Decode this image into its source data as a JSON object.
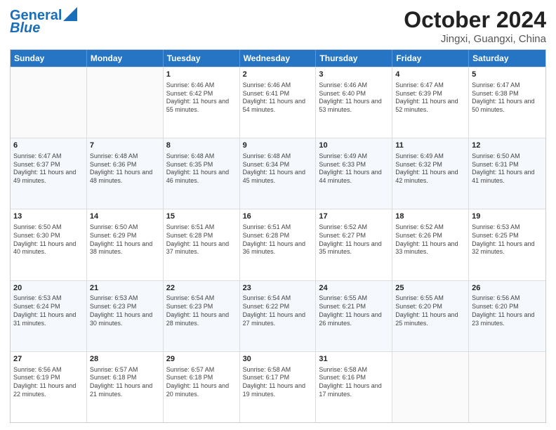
{
  "logo": {
    "line1": "General",
    "line2": "Blue"
  },
  "title": "October 2024",
  "subtitle": "Jingxi, Guangxi, China",
  "weekdays": [
    "Sunday",
    "Monday",
    "Tuesday",
    "Wednesday",
    "Thursday",
    "Friday",
    "Saturday"
  ],
  "weeks": [
    [
      {
        "day": "",
        "sunrise": "",
        "sunset": "",
        "daylight": ""
      },
      {
        "day": "",
        "sunrise": "",
        "sunset": "",
        "daylight": ""
      },
      {
        "day": "1",
        "sunrise": "Sunrise: 6:46 AM",
        "sunset": "Sunset: 6:42 PM",
        "daylight": "Daylight: 11 hours and 55 minutes."
      },
      {
        "day": "2",
        "sunrise": "Sunrise: 6:46 AM",
        "sunset": "Sunset: 6:41 PM",
        "daylight": "Daylight: 11 hours and 54 minutes."
      },
      {
        "day": "3",
        "sunrise": "Sunrise: 6:46 AM",
        "sunset": "Sunset: 6:40 PM",
        "daylight": "Daylight: 11 hours and 53 minutes."
      },
      {
        "day": "4",
        "sunrise": "Sunrise: 6:47 AM",
        "sunset": "Sunset: 6:39 PM",
        "daylight": "Daylight: 11 hours and 52 minutes."
      },
      {
        "day": "5",
        "sunrise": "Sunrise: 6:47 AM",
        "sunset": "Sunset: 6:38 PM",
        "daylight": "Daylight: 11 hours and 50 minutes."
      }
    ],
    [
      {
        "day": "6",
        "sunrise": "Sunrise: 6:47 AM",
        "sunset": "Sunset: 6:37 PM",
        "daylight": "Daylight: 11 hours and 49 minutes."
      },
      {
        "day": "7",
        "sunrise": "Sunrise: 6:48 AM",
        "sunset": "Sunset: 6:36 PM",
        "daylight": "Daylight: 11 hours and 48 minutes."
      },
      {
        "day": "8",
        "sunrise": "Sunrise: 6:48 AM",
        "sunset": "Sunset: 6:35 PM",
        "daylight": "Daylight: 11 hours and 46 minutes."
      },
      {
        "day": "9",
        "sunrise": "Sunrise: 6:48 AM",
        "sunset": "Sunset: 6:34 PM",
        "daylight": "Daylight: 11 hours and 45 minutes."
      },
      {
        "day": "10",
        "sunrise": "Sunrise: 6:49 AM",
        "sunset": "Sunset: 6:33 PM",
        "daylight": "Daylight: 11 hours and 44 minutes."
      },
      {
        "day": "11",
        "sunrise": "Sunrise: 6:49 AM",
        "sunset": "Sunset: 6:32 PM",
        "daylight": "Daylight: 11 hours and 42 minutes."
      },
      {
        "day": "12",
        "sunrise": "Sunrise: 6:50 AM",
        "sunset": "Sunset: 6:31 PM",
        "daylight": "Daylight: 11 hours and 41 minutes."
      }
    ],
    [
      {
        "day": "13",
        "sunrise": "Sunrise: 6:50 AM",
        "sunset": "Sunset: 6:30 PM",
        "daylight": "Daylight: 11 hours and 40 minutes."
      },
      {
        "day": "14",
        "sunrise": "Sunrise: 6:50 AM",
        "sunset": "Sunset: 6:29 PM",
        "daylight": "Daylight: 11 hours and 38 minutes."
      },
      {
        "day": "15",
        "sunrise": "Sunrise: 6:51 AM",
        "sunset": "Sunset: 6:28 PM",
        "daylight": "Daylight: 11 hours and 37 minutes."
      },
      {
        "day": "16",
        "sunrise": "Sunrise: 6:51 AM",
        "sunset": "Sunset: 6:28 PM",
        "daylight": "Daylight: 11 hours and 36 minutes."
      },
      {
        "day": "17",
        "sunrise": "Sunrise: 6:52 AM",
        "sunset": "Sunset: 6:27 PM",
        "daylight": "Daylight: 11 hours and 35 minutes."
      },
      {
        "day": "18",
        "sunrise": "Sunrise: 6:52 AM",
        "sunset": "Sunset: 6:26 PM",
        "daylight": "Daylight: 11 hours and 33 minutes."
      },
      {
        "day": "19",
        "sunrise": "Sunrise: 6:53 AM",
        "sunset": "Sunset: 6:25 PM",
        "daylight": "Daylight: 11 hours and 32 minutes."
      }
    ],
    [
      {
        "day": "20",
        "sunrise": "Sunrise: 6:53 AM",
        "sunset": "Sunset: 6:24 PM",
        "daylight": "Daylight: 11 hours and 31 minutes."
      },
      {
        "day": "21",
        "sunrise": "Sunrise: 6:53 AM",
        "sunset": "Sunset: 6:23 PM",
        "daylight": "Daylight: 11 hours and 30 minutes."
      },
      {
        "day": "22",
        "sunrise": "Sunrise: 6:54 AM",
        "sunset": "Sunset: 6:23 PM",
        "daylight": "Daylight: 11 hours and 28 minutes."
      },
      {
        "day": "23",
        "sunrise": "Sunrise: 6:54 AM",
        "sunset": "Sunset: 6:22 PM",
        "daylight": "Daylight: 11 hours and 27 minutes."
      },
      {
        "day": "24",
        "sunrise": "Sunrise: 6:55 AM",
        "sunset": "Sunset: 6:21 PM",
        "daylight": "Daylight: 11 hours and 26 minutes."
      },
      {
        "day": "25",
        "sunrise": "Sunrise: 6:55 AM",
        "sunset": "Sunset: 6:20 PM",
        "daylight": "Daylight: 11 hours and 25 minutes."
      },
      {
        "day": "26",
        "sunrise": "Sunrise: 6:56 AM",
        "sunset": "Sunset: 6:20 PM",
        "daylight": "Daylight: 11 hours and 23 minutes."
      }
    ],
    [
      {
        "day": "27",
        "sunrise": "Sunrise: 6:56 AM",
        "sunset": "Sunset: 6:19 PM",
        "daylight": "Daylight: 11 hours and 22 minutes."
      },
      {
        "day": "28",
        "sunrise": "Sunrise: 6:57 AM",
        "sunset": "Sunset: 6:18 PM",
        "daylight": "Daylight: 11 hours and 21 minutes."
      },
      {
        "day": "29",
        "sunrise": "Sunrise: 6:57 AM",
        "sunset": "Sunset: 6:18 PM",
        "daylight": "Daylight: 11 hours and 20 minutes."
      },
      {
        "day": "30",
        "sunrise": "Sunrise: 6:58 AM",
        "sunset": "Sunset: 6:17 PM",
        "daylight": "Daylight: 11 hours and 19 minutes."
      },
      {
        "day": "31",
        "sunrise": "Sunrise: 6:58 AM",
        "sunset": "Sunset: 6:16 PM",
        "daylight": "Daylight: 11 hours and 17 minutes."
      },
      {
        "day": "",
        "sunrise": "",
        "sunset": "",
        "daylight": ""
      },
      {
        "day": "",
        "sunrise": "",
        "sunset": "",
        "daylight": ""
      }
    ]
  ]
}
